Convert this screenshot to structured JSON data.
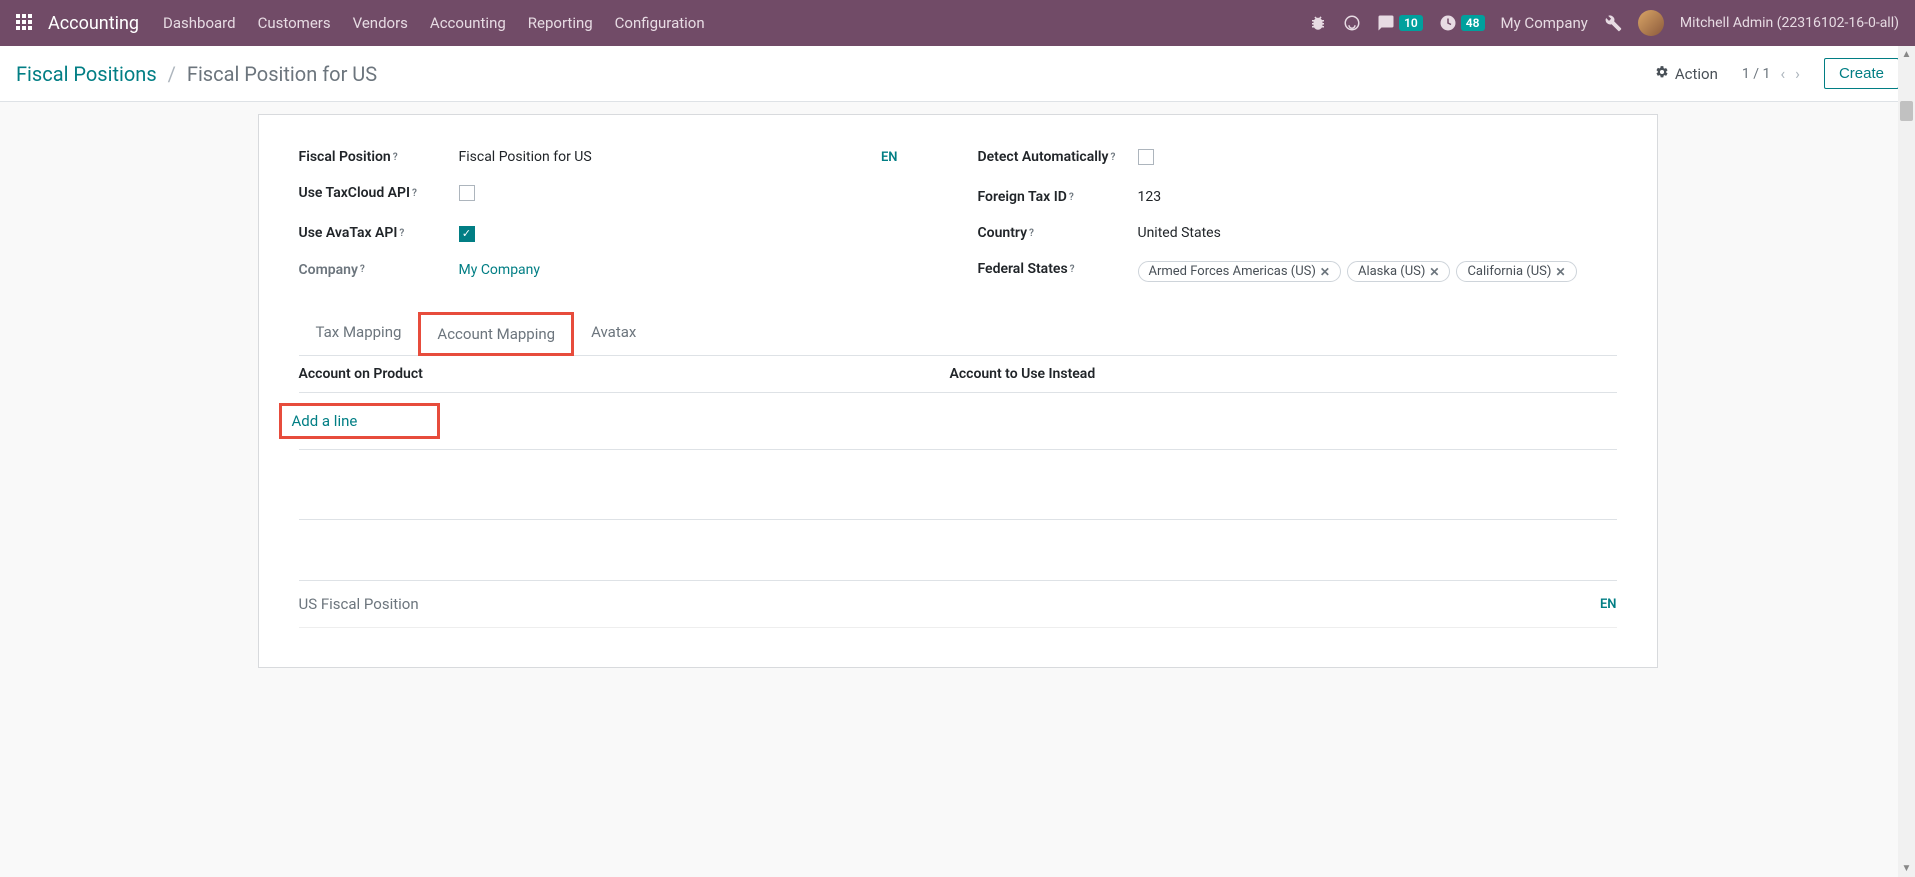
{
  "nav": {
    "brand": "Accounting",
    "menu": [
      "Dashboard",
      "Customers",
      "Vendors",
      "Accounting",
      "Reporting",
      "Configuration"
    ],
    "messages_count": "10",
    "activities_count": "48",
    "company": "My Company",
    "user": "Mitchell Admin (22316102-16-0-all)"
  },
  "breadcrumb": {
    "parent": "Fiscal Positions",
    "current": "Fiscal Position for US"
  },
  "action_label": "Action",
  "pager": "1 / 1",
  "create_label": "Create",
  "form": {
    "fiscal_position_label": "Fiscal Position",
    "fiscal_position_value": "Fiscal Position for US",
    "lang": "EN",
    "taxcloud_label": "Use TaxCloud API",
    "avatax_label": "Use AvaTax API",
    "company_label": "Company",
    "company_value": "My Company",
    "detect_label": "Detect Automatically",
    "foreign_tax_label": "Foreign Tax ID",
    "foreign_tax_value": "123",
    "country_label": "Country",
    "country_value": "United States",
    "states_label": "Federal States",
    "states": [
      "Armed Forces Americas (US)",
      "Alaska (US)",
      "California (US)"
    ]
  },
  "tabs": {
    "tax": "Tax Mapping",
    "account": "Account Mapping",
    "avatax": "Avatax"
  },
  "columns": {
    "product": "Account on Product",
    "instead": "Account to Use Instead"
  },
  "add_line": "Add a line",
  "notes": "US Fiscal Position",
  "notes_lang": "EN"
}
